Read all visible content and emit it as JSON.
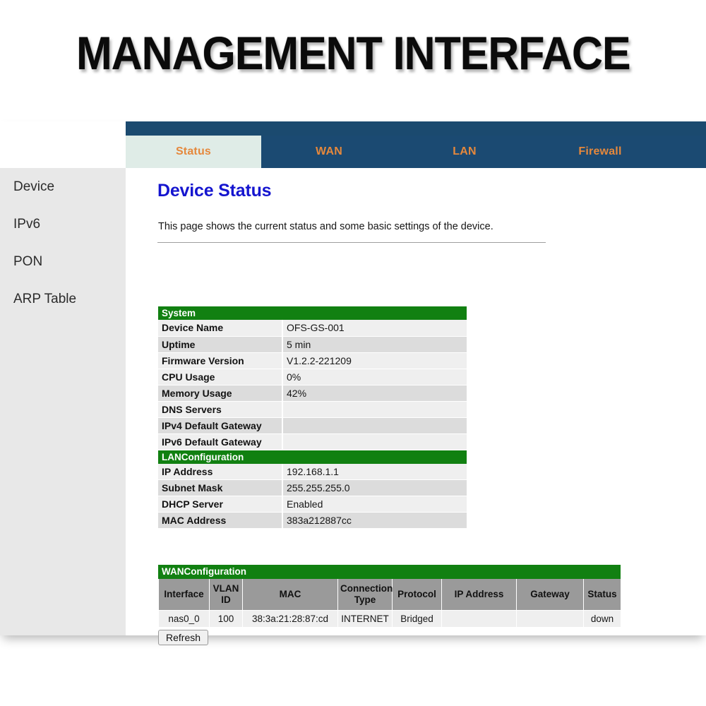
{
  "banner": {
    "title": "MANAGEMENT INTERFACE"
  },
  "colors": {
    "nav_bg": "#1b4a72",
    "nav_text": "#e5883c",
    "active_tab_bg": "#dfece7",
    "section_green": "#118011",
    "title_blue": "#1515cf",
    "sidebar_bg": "#e8e8e8",
    "table_header_gray": "#9a9a9a",
    "row_odd": "#efefef",
    "row_even": "#dcdcdc"
  },
  "nav": {
    "tabs": [
      {
        "label": "Status",
        "active": true
      },
      {
        "label": "WAN",
        "active": false
      },
      {
        "label": "LAN",
        "active": false
      },
      {
        "label": "Firewall",
        "active": false
      }
    ]
  },
  "sidebar": {
    "items": [
      {
        "label": "Device"
      },
      {
        "label": "IPv6"
      },
      {
        "label": "PON"
      },
      {
        "label": "ARP Table"
      }
    ]
  },
  "main": {
    "title": "Device Status",
    "description": "This page shows the current status and some basic settings of the device.",
    "system_section": {
      "heading": "System",
      "rows": [
        {
          "key": "Device Name",
          "value": "OFS-GS-001"
        },
        {
          "key": "Uptime",
          "value": "5 min"
        },
        {
          "key": "Firmware Version",
          "value": "V1.2.2-221209"
        },
        {
          "key": "CPU Usage",
          "value": "0%"
        },
        {
          "key": "Memory Usage",
          "value": "42%"
        },
        {
          "key": "DNS Servers",
          "value": ""
        },
        {
          "key": "IPv4 Default Gateway",
          "value": ""
        },
        {
          "key": "IPv6 Default Gateway",
          "value": ""
        }
      ]
    },
    "lan_section": {
      "heading": "LANConfiguration",
      "rows": [
        {
          "key": "IP Address",
          "value": "192.168.1.1"
        },
        {
          "key": "Subnet Mask",
          "value": "255.255.255.0"
        },
        {
          "key": "DHCP Server",
          "value": "Enabled"
        },
        {
          "key": "MAC Address",
          "value": "383a212887cc"
        }
      ]
    },
    "wan_section": {
      "heading": "WANConfiguration",
      "columns": [
        "Interface",
        "VLAN ID",
        "MAC",
        "Connection Type",
        "Protocol",
        "IP Address",
        "Gateway",
        "Status"
      ],
      "rows": [
        {
          "interface": "nas0_0",
          "vlan_id": "100",
          "mac": "38:3a:21:28:87:cd",
          "connection_type": "INTERNET",
          "protocol": "Bridged",
          "ip_address": "",
          "gateway": "",
          "status": "down"
        }
      ],
      "refresh_label": "Refresh"
    }
  }
}
